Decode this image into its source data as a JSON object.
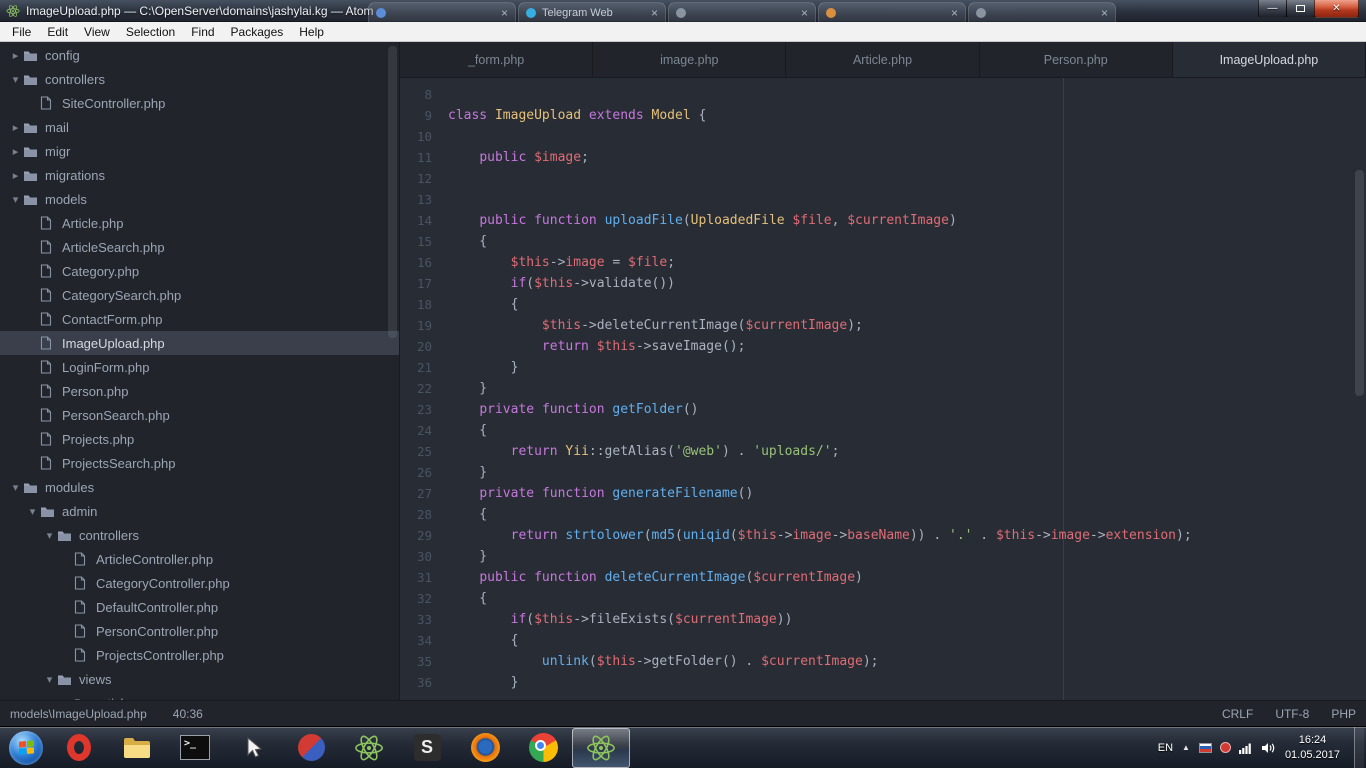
{
  "window": {
    "title": "ImageUpload.php — C:\\OpenServer\\domains\\jashylai.kg — Atom",
    "buttons": [
      "minimize-button",
      "maximize-button",
      "close-button"
    ],
    "background_tabs": [
      {
        "label": "",
        "color": "#5b8dd9"
      },
      {
        "label": "Telegram Web",
        "color": "#37aee2"
      },
      {
        "label": "",
        "color": "#8a94a0"
      },
      {
        "label": "",
        "color": "#d98f3d"
      },
      {
        "label": "",
        "color": "#8a94a0"
      }
    ]
  },
  "menu": {
    "items": [
      "File",
      "Edit",
      "View",
      "Selection",
      "Find",
      "Packages",
      "Help"
    ]
  },
  "tree": {
    "items": [
      {
        "label": "config",
        "level": 0,
        "type": "folder",
        "state": "collapsed"
      },
      {
        "label": "controllers",
        "level": 0,
        "type": "folder",
        "state": "expanded"
      },
      {
        "label": "SiteController.php",
        "level": 1,
        "type": "file"
      },
      {
        "label": "mail",
        "level": 0,
        "type": "folder",
        "state": "collapsed"
      },
      {
        "label": "migr",
        "level": 0,
        "type": "folder",
        "state": "collapsed"
      },
      {
        "label": "migrations",
        "level": 0,
        "type": "folder",
        "state": "collapsed"
      },
      {
        "label": "models",
        "level": 0,
        "type": "folder",
        "state": "expanded"
      },
      {
        "label": "Article.php",
        "level": 1,
        "type": "file"
      },
      {
        "label": "ArticleSearch.php",
        "level": 1,
        "type": "file"
      },
      {
        "label": "Category.php",
        "level": 1,
        "type": "file"
      },
      {
        "label": "CategorySearch.php",
        "level": 1,
        "type": "file"
      },
      {
        "label": "ContactForm.php",
        "level": 1,
        "type": "file"
      },
      {
        "label": "ImageUpload.php",
        "level": 1,
        "type": "file",
        "selected": true
      },
      {
        "label": "LoginForm.php",
        "level": 1,
        "type": "file"
      },
      {
        "label": "Person.php",
        "level": 1,
        "type": "file"
      },
      {
        "label": "PersonSearch.php",
        "level": 1,
        "type": "file"
      },
      {
        "label": "Projects.php",
        "level": 1,
        "type": "file"
      },
      {
        "label": "ProjectsSearch.php",
        "level": 1,
        "type": "file"
      },
      {
        "label": "modules",
        "level": 0,
        "type": "folder",
        "state": "expanded"
      },
      {
        "label": "admin",
        "level": 1,
        "type": "folder",
        "state": "expanded"
      },
      {
        "label": "controllers",
        "level": 2,
        "type": "folder",
        "state": "expanded"
      },
      {
        "label": "ArticleController.php",
        "level": 3,
        "type": "file"
      },
      {
        "label": "CategoryController.php",
        "level": 3,
        "type": "file"
      },
      {
        "label": "DefaultController.php",
        "level": 3,
        "type": "file"
      },
      {
        "label": "PersonController.php",
        "level": 3,
        "type": "file"
      },
      {
        "label": "ProjectsController.php",
        "level": 3,
        "type": "file"
      },
      {
        "label": "views",
        "level": 2,
        "type": "folder",
        "state": "expanded"
      },
      {
        "label": "article",
        "level": 3,
        "type": "folder",
        "state": "collapsed"
      }
    ]
  },
  "tabs": [
    {
      "label": "_form.php",
      "active": false
    },
    {
      "label": "image.php",
      "active": false
    },
    {
      "label": "Article.php",
      "active": false
    },
    {
      "label": "Person.php",
      "active": false
    },
    {
      "label": "ImageUpload.php",
      "active": true
    }
  ],
  "editor": {
    "lines": [
      {
        "n": 8,
        "t": []
      },
      {
        "n": 9,
        "t": [
          [
            "class",
            "k"
          ],
          [
            " ",
            "p"
          ],
          [
            "ImageUpload",
            "c"
          ],
          [
            " ",
            "p"
          ],
          [
            "extends",
            "k"
          ],
          [
            " ",
            "p"
          ],
          [
            "Model",
            "c"
          ],
          [
            " {",
            "p"
          ]
        ]
      },
      {
        "n": 10,
        "t": []
      },
      {
        "n": 11,
        "t": [
          [
            "    ",
            "p"
          ],
          [
            "public",
            "k"
          ],
          [
            " ",
            "p"
          ],
          [
            "$image",
            "v"
          ],
          [
            ";",
            "p"
          ]
        ]
      },
      {
        "n": 12,
        "t": []
      },
      {
        "n": 13,
        "t": []
      },
      {
        "n": 14,
        "t": [
          [
            "    ",
            "p"
          ],
          [
            "public",
            "k"
          ],
          [
            " ",
            "p"
          ],
          [
            "function",
            "k"
          ],
          [
            " ",
            "p"
          ],
          [
            "uploadFile",
            "f"
          ],
          [
            "(",
            "p"
          ],
          [
            "UploadedFile",
            "c"
          ],
          [
            " ",
            "p"
          ],
          [
            "$file",
            "v"
          ],
          [
            ", ",
            "p"
          ],
          [
            "$currentImage",
            "v"
          ],
          [
            ")",
            "p"
          ]
        ]
      },
      {
        "n": 15,
        "t": [
          [
            "    {",
            "p"
          ]
        ]
      },
      {
        "n": 16,
        "t": [
          [
            "        ",
            "p"
          ],
          [
            "$this",
            "v"
          ],
          [
            "->",
            "p"
          ],
          [
            "image",
            "v"
          ],
          [
            " = ",
            "p"
          ],
          [
            "$file",
            "v"
          ],
          [
            ";",
            "p"
          ]
        ]
      },
      {
        "n": 17,
        "t": [
          [
            "        ",
            "p"
          ],
          [
            "if",
            "k"
          ],
          [
            "(",
            "p"
          ],
          [
            "$this",
            "v"
          ],
          [
            "->validate())",
            "p"
          ]
        ]
      },
      {
        "n": 18,
        "t": [
          [
            "        {",
            "p"
          ]
        ]
      },
      {
        "n": 19,
        "t": [
          [
            "            ",
            "p"
          ],
          [
            "$this",
            "v"
          ],
          [
            "->deleteCurrentImage(",
            "p"
          ],
          [
            "$currentImage",
            "v"
          ],
          [
            ");",
            "p"
          ]
        ]
      },
      {
        "n": 20,
        "t": [
          [
            "            ",
            "p"
          ],
          [
            "return",
            "k"
          ],
          [
            " ",
            "p"
          ],
          [
            "$this",
            "v"
          ],
          [
            "->saveImage();",
            "p"
          ]
        ]
      },
      {
        "n": 21,
        "t": [
          [
            "        }",
            "p"
          ]
        ]
      },
      {
        "n": 22,
        "t": [
          [
            "    }",
            "p"
          ]
        ]
      },
      {
        "n": 23,
        "t": [
          [
            "    ",
            "p"
          ],
          [
            "private",
            "k"
          ],
          [
            " ",
            "p"
          ],
          [
            "function",
            "k"
          ],
          [
            " ",
            "p"
          ],
          [
            "getFolder",
            "f"
          ],
          [
            "()",
            "p"
          ]
        ]
      },
      {
        "n": 24,
        "t": [
          [
            "    {",
            "p"
          ]
        ]
      },
      {
        "n": 25,
        "t": [
          [
            "        ",
            "p"
          ],
          [
            "return",
            "k"
          ],
          [
            " ",
            "p"
          ],
          [
            "Yii",
            "c"
          ],
          [
            "::getAlias(",
            "p"
          ],
          [
            "'@web'",
            "s"
          ],
          [
            ") . ",
            "p"
          ],
          [
            "'uploads/'",
            "s"
          ],
          [
            ";",
            "p"
          ]
        ]
      },
      {
        "n": 26,
        "t": [
          [
            "    }",
            "p"
          ]
        ]
      },
      {
        "n": 27,
        "t": [
          [
            "    ",
            "p"
          ],
          [
            "private",
            "k"
          ],
          [
            " ",
            "p"
          ],
          [
            "function",
            "k"
          ],
          [
            " ",
            "p"
          ],
          [
            "generateFilename",
            "f"
          ],
          [
            "()",
            "p"
          ]
        ]
      },
      {
        "n": 28,
        "t": [
          [
            "    {",
            "p"
          ]
        ]
      },
      {
        "n": 29,
        "t": [
          [
            "        ",
            "p"
          ],
          [
            "return",
            "k"
          ],
          [
            " ",
            "p"
          ],
          [
            "strtolower",
            "f"
          ],
          [
            "(",
            "p"
          ],
          [
            "md5",
            "f"
          ],
          [
            "(",
            "p"
          ],
          [
            "uniqid",
            "f"
          ],
          [
            "(",
            "p"
          ],
          [
            "$this",
            "v"
          ],
          [
            "->",
            "p"
          ],
          [
            "image",
            "v"
          ],
          [
            "->",
            "p"
          ],
          [
            "baseName",
            "v"
          ],
          [
            ")) . ",
            "p"
          ],
          [
            "'.'",
            "s"
          ],
          [
            " . ",
            "p"
          ],
          [
            "$this",
            "v"
          ],
          [
            "->",
            "p"
          ],
          [
            "image",
            "v"
          ],
          [
            "->",
            "p"
          ],
          [
            "extension",
            "v"
          ],
          [
            ");",
            "p"
          ]
        ]
      },
      {
        "n": 30,
        "t": [
          [
            "    }",
            "p"
          ]
        ]
      },
      {
        "n": 31,
        "t": [
          [
            "    ",
            "p"
          ],
          [
            "public",
            "k"
          ],
          [
            " ",
            "p"
          ],
          [
            "function",
            "k"
          ],
          [
            " ",
            "p"
          ],
          [
            "deleteCurrentImage",
            "f"
          ],
          [
            "(",
            "p"
          ],
          [
            "$currentImage",
            "v"
          ],
          [
            ")",
            "p"
          ]
        ]
      },
      {
        "n": 32,
        "t": [
          [
            "    {",
            "p"
          ]
        ]
      },
      {
        "n": 33,
        "t": [
          [
            "        ",
            "p"
          ],
          [
            "if",
            "k"
          ],
          [
            "(",
            "p"
          ],
          [
            "$this",
            "v"
          ],
          [
            "->fileExists(",
            "p"
          ],
          [
            "$currentImage",
            "v"
          ],
          [
            "))",
            "p"
          ]
        ]
      },
      {
        "n": 34,
        "t": [
          [
            "        {",
            "p"
          ]
        ]
      },
      {
        "n": 35,
        "t": [
          [
            "            ",
            "p"
          ],
          [
            "unlink",
            "f"
          ],
          [
            "(",
            "p"
          ],
          [
            "$this",
            "v"
          ],
          [
            "->getFolder() . ",
            "p"
          ],
          [
            "$currentImage",
            "v"
          ],
          [
            ");",
            "p"
          ]
        ]
      },
      {
        "n": 36,
        "t": [
          [
            "        }",
            "p"
          ]
        ]
      }
    ]
  },
  "status": {
    "path": "models\\ImageUpload.php",
    "cursor": "40:36",
    "right_items": [
      "CRLF",
      "UTF-8",
      "PHP"
    ]
  },
  "taskbar": {
    "icons": [
      {
        "name": "start-button"
      },
      {
        "name": "opera-icon"
      },
      {
        "name": "explorer-icon"
      },
      {
        "name": "terminal-icon"
      },
      {
        "name": "pointer-tool-icon"
      },
      {
        "name": "media-app-icon"
      },
      {
        "name": "atom-icon"
      },
      {
        "name": "sublime-text-icon"
      },
      {
        "name": "firefox-icon"
      },
      {
        "name": "chrome-icon"
      },
      {
        "name": "atom-icon-active",
        "active": true
      }
    ],
    "tray": {
      "language": "EN",
      "icons": [
        "flag-icon",
        "alert-icon",
        "network-icon",
        "volume-icon"
      ],
      "time": "16:24",
      "date": "01.05.2017"
    }
  }
}
